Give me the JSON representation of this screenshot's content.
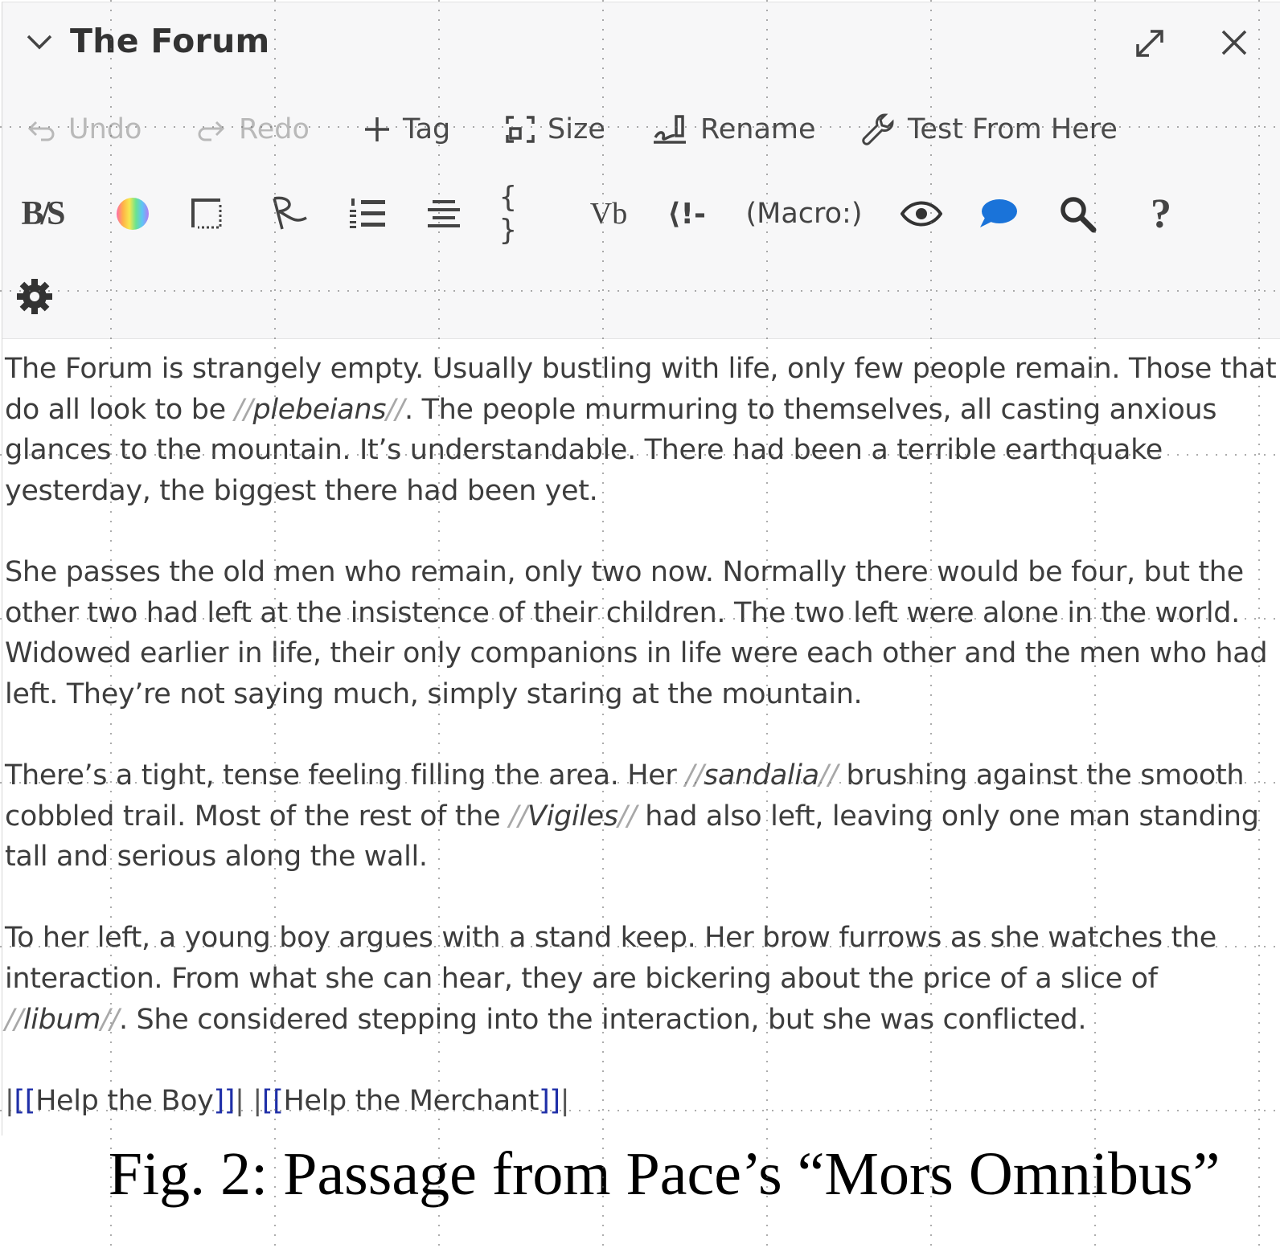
{
  "header": {
    "title": "The Forum"
  },
  "actions": [
    {
      "label": "Undo",
      "icon": "undo-icon",
      "enabled": false
    },
    {
      "label": "Redo",
      "icon": "redo-icon",
      "enabled": false
    },
    {
      "label": "Tag",
      "icon": "plus-icon",
      "enabled": true
    },
    {
      "label": "Size",
      "icon": "size-icon",
      "enabled": true
    },
    {
      "label": "Rename",
      "icon": "signature-icon",
      "enabled": true
    },
    {
      "label": "Test From Here",
      "icon": "wrench-icon",
      "enabled": true
    }
  ],
  "format_toolbar": {
    "bold_strike": "B/S",
    "colour": "colour-wheel-icon",
    "border": "border-icon",
    "text_style": "text-style-icon",
    "list": "numbered-list-icon",
    "align": "align-center-icon",
    "collapse": "{ }",
    "verbatim": "Vb",
    "comment": "⟨!-",
    "macro": "(Macro:)",
    "preview": "eye-icon",
    "speech": "speech-bubble-icon",
    "find": "search-icon",
    "help": "?",
    "settings": "gear-icon"
  },
  "colors": {
    "accent_blue": "#1a73d9",
    "link_bracket": "#1f2fa8",
    "toolbar_bg": "#f7f7f8"
  },
  "passage": {
    "p1_a": "The Forum is strangely empty. Usually bustling with life, only few people remain. Those that do all look to be ",
    "p1_word": "plebeians",
    "p1_b": ". The people murmuring to themselves, all casting anxious glances to the mountain. It’s understandable. There had been a terrible earthquake yesterday, the biggest there had been yet.",
    "p2": "She passes the old men who remain, only two now. Normally there would be four, but the other two had left at the insistence of their children. The two left were alone in the world. Widowed earlier in life, their only companions in life were each other and the men who had left. They’re not saying much, simply staring at the mountain.",
    "p3_a": "There’s a tight, tense feeling filling the area. Her ",
    "p3_word1": "sandalia",
    "p3_b": " brushing against the smooth cobbled trail. Most of the rest of the ",
    "p3_word2": "Vigiles",
    "p3_c": " had also left, leaving only one man standing tall and serious along the wall.",
    "p4_a": "To her left, a young boy argues with a stand keep. Her brow furrows as she watches the interaction. From what she can hear, they are bickering about the price of a slice of ",
    "p4_word": "libum",
    "p4_b": ". She considered stepping into the interaction, but she was conflicted.",
    "slashes": "//",
    "pipe": "|",
    "open_brackets": "[[",
    "close_brackets": "]]",
    "link1": "Help the Boy",
    "link2": "Help the Merchant"
  },
  "caption": "Fig. 2: Passage from Pace’s “Mors Omnibus”"
}
